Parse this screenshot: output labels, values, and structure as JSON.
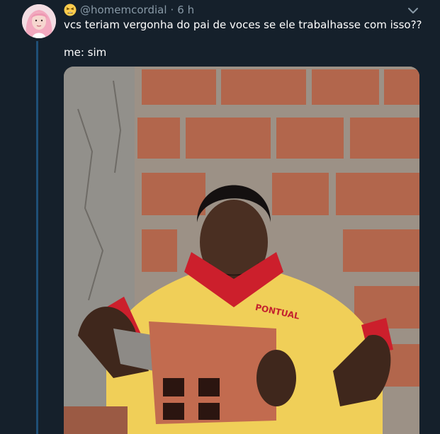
{
  "tweet": {
    "handle": "@homemcordial",
    "separator": "·",
    "time": "6 h",
    "text_line1": "vcs teriam vergonha do pai de voces se ele trabalhasse com isso??",
    "text_line2": "me: sim",
    "header_emoji": "tired-face-emoji-icon",
    "menu_icon": "chevron-down-icon"
  },
  "photo": {
    "shirt_logo": "PONTUAL"
  },
  "colors": {
    "background": "#15202b",
    "secondary_text": "#8899a6",
    "thread_line": "#1f4f76"
  }
}
